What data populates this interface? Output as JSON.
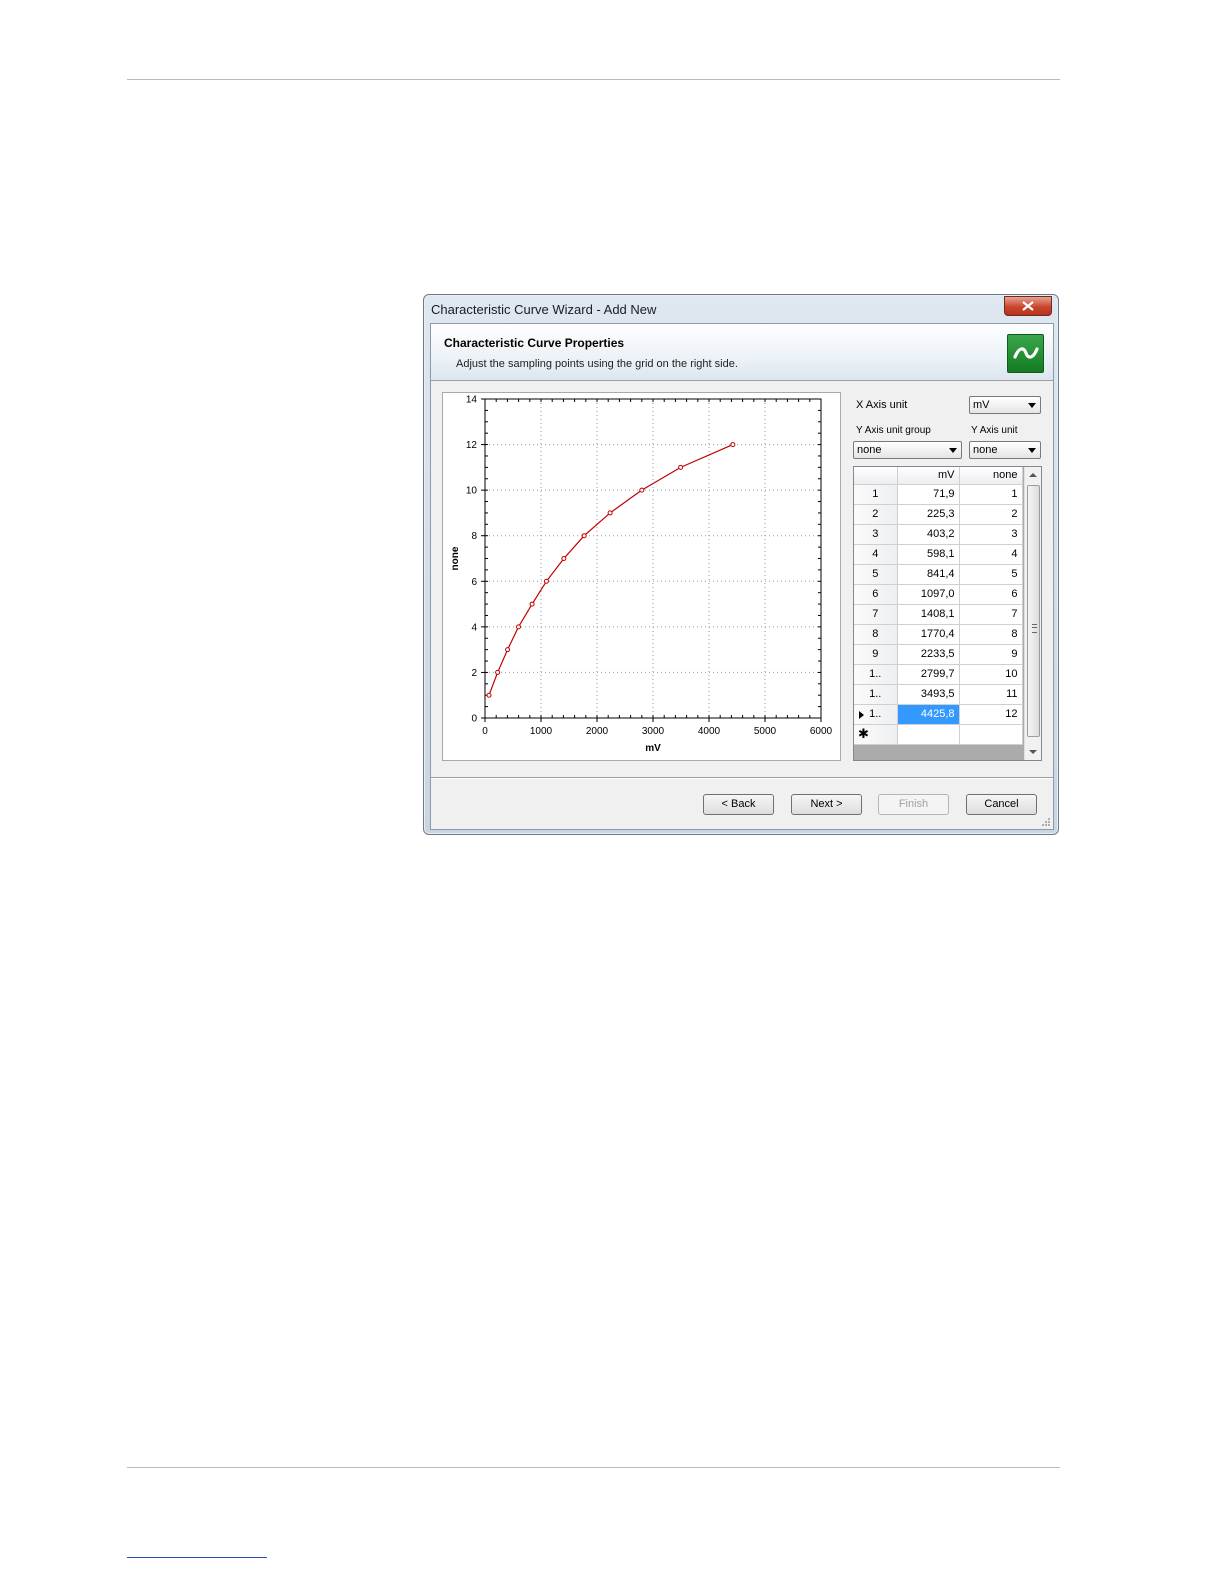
{
  "window": {
    "title": "Characteristic Curve Wizard - Add New"
  },
  "header": {
    "title": "Characteristic Curve Properties",
    "subtitle": "Adjust the sampling points using the grid on the right side."
  },
  "controls": {
    "x_axis_unit_label": "X Axis unit",
    "x_axis_unit_value": "mV",
    "y_axis_unit_group_label": "Y Axis unit group",
    "y_axis_unit_group_value": "none",
    "y_axis_unit_label": "Y Axis unit",
    "y_axis_unit_value": "none"
  },
  "grid": {
    "columns": [
      "mV",
      "none"
    ],
    "rows": [
      {
        "index": "1",
        "x": "71,9",
        "y": "1"
      },
      {
        "index": "2",
        "x": "225,3",
        "y": "2"
      },
      {
        "index": "3",
        "x": "403,2",
        "y": "3"
      },
      {
        "index": "4",
        "x": "598,1",
        "y": "4"
      },
      {
        "index": "5",
        "x": "841,4",
        "y": "5"
      },
      {
        "index": "6",
        "x": "1097,0",
        "y": "6"
      },
      {
        "index": "7",
        "x": "1408,1",
        "y": "7"
      },
      {
        "index": "8",
        "x": "1770,4",
        "y": "8"
      },
      {
        "index": "9",
        "x": "2233,5",
        "y": "9"
      },
      {
        "index": "1..",
        "x": "2799,7",
        "y": "10"
      },
      {
        "index": "1..",
        "x": "3493,5",
        "y": "11"
      },
      {
        "index": "1..",
        "x": "4425,8",
        "y": "12"
      }
    ],
    "selected_row": 11,
    "new_row_marker": "✱"
  },
  "buttons": {
    "back": "< Back",
    "next": "Next >",
    "finish": "Finish",
    "cancel": "Cancel"
  },
  "chart_data": {
    "type": "line",
    "xlabel": "mV",
    "ylabel": "none",
    "xlim": [
      0,
      6000
    ],
    "ylim": [
      0,
      14
    ],
    "xticks": [
      "0",
      "1000",
      "2000",
      "3000",
      "4000",
      "5000",
      "6000"
    ],
    "yticks": [
      "0",
      "2",
      "4",
      "6",
      "8",
      "10",
      "12",
      "14"
    ],
    "grid": true,
    "series": [
      {
        "color": "#c00000",
        "x": [
          71.9,
          225.3,
          403.2,
          598.1,
          841.4,
          1097.0,
          1408.1,
          1770.4,
          2233.5,
          2799.7,
          3493.5,
          4425.8
        ],
        "y": [
          1,
          2,
          3,
          4,
          5,
          6,
          7,
          8,
          9,
          10,
          11,
          12
        ]
      }
    ]
  }
}
